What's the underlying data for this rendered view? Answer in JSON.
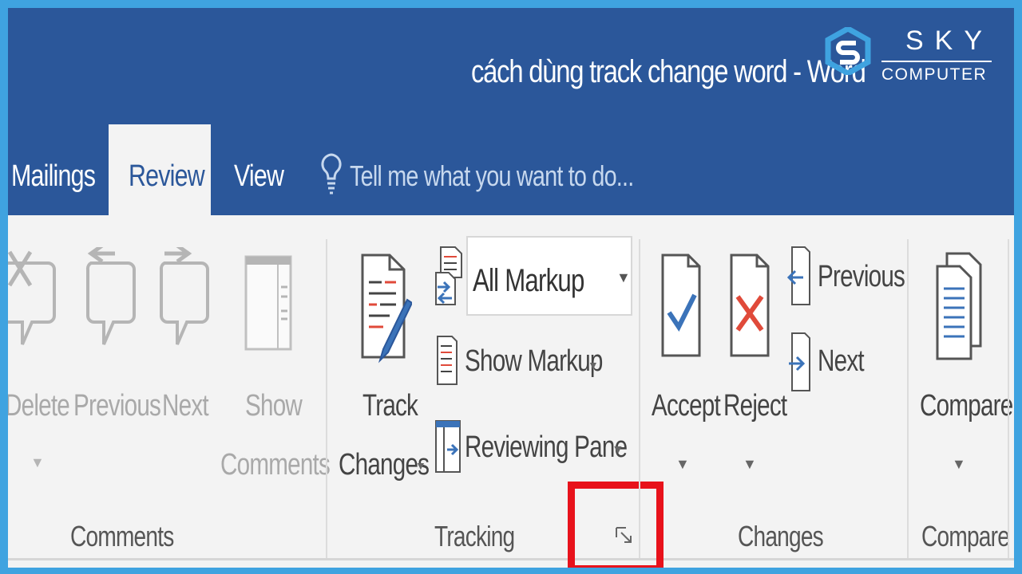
{
  "window": {
    "title": "cách dùng track change word - Word"
  },
  "brand": {
    "name_top": "SKY",
    "name_bottom": "COMPUTER",
    "mark_icon": "sky-logo-icon"
  },
  "tabs": [
    {
      "label": "Mailings",
      "selected": false
    },
    {
      "label": "Review",
      "selected": true
    },
    {
      "label": "View",
      "selected": false
    }
  ],
  "tell_me": {
    "placeholder": "Tell me what you want to do...",
    "icon": "lightbulb-icon"
  },
  "groups": {
    "comments": {
      "label": "Comments",
      "delete": {
        "label": "Delete",
        "icon": "delete-comment-icon"
      },
      "previous": {
        "label": "Previous",
        "icon": "previous-comment-icon"
      },
      "next": {
        "label": "Next",
        "icon": "next-comment-icon"
      },
      "show": {
        "label_line1": "Show",
        "label_line2": "Comments",
        "icon": "show-comments-icon"
      }
    },
    "tracking": {
      "label": "Tracking",
      "track_changes": {
        "label_line1": "Track",
        "label_line2": "Changes",
        "icon": "track-changes-icon"
      },
      "markup_select": {
        "value": "All Markup",
        "icon": "display-for-review-icon"
      },
      "show_markup": {
        "label": "Show Markup",
        "icon": "show-markup-icon"
      },
      "reviewing_pane": {
        "label": "Reviewing Pane",
        "icon": "reviewing-pane-icon"
      },
      "dialog_launcher": {
        "icon": "dialog-launcher-icon",
        "highlighted": true
      }
    },
    "changes": {
      "label": "Changes",
      "accept": {
        "label": "Accept",
        "icon": "accept-icon"
      },
      "reject": {
        "label": "Reject",
        "icon": "reject-icon"
      },
      "previous": {
        "label": "Previous",
        "icon": "previous-change-icon"
      },
      "next": {
        "label": "Next",
        "icon": "next-change-icon"
      }
    },
    "compare": {
      "label": "Compare",
      "compare": {
        "label": "Compare",
        "icon": "compare-icon"
      }
    }
  },
  "colors": {
    "title_bar": "#2b579a",
    "ribbon": "#f3f3f3",
    "highlight": "#e8121b",
    "accent_blue": "#3b73b9",
    "reject_red": "#e04a3a",
    "outer_frame": "#3fa3e0"
  }
}
